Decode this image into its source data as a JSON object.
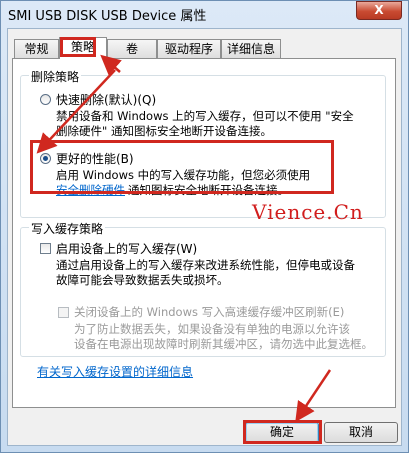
{
  "window": {
    "title": "SMI USB DISK USB Device 属性",
    "close_label": "X"
  },
  "tabs": [
    {
      "label": "常规"
    },
    {
      "label": "策略"
    },
    {
      "label": "卷"
    },
    {
      "label": "驱动程序"
    },
    {
      "label": "详细信息"
    }
  ],
  "removal_policy": {
    "title": "删除策略",
    "quick_label": "快速删除(默认)(Q)",
    "quick_desc_1": "禁用设备和 Windows 上的写入缓存，但可以不使用 \"安全",
    "quick_desc_2": "删除硬件\" 通知图标安全地断开设备连接。",
    "better_label": "更好的性能(B)",
    "better_desc_1": "启用 Windows 中的写入缓存功能，但您必须使用",
    "better_desc_link": "安全删除硬件",
    "better_desc_2": "通知图标安全地断开设备连接。"
  },
  "write_cache": {
    "title": "写入缓存策略",
    "enable_label": "启用设备上的写入缓存(W)",
    "enable_desc_1": "通过启用设备上的写入缓存来改进系统性能，但停电或设备",
    "enable_desc_2": "故障可能会导致数据丢失或损坏。",
    "flush_label": "关闭设备上的 Windows 写入高速缓存缓冲区刷新(E)",
    "flush_desc_1": "为了防止数据丢失，如果设备没有单独的电源以允许该",
    "flush_desc_2": "设备在电源出现故障时刷新其缓冲区，请勿选中此复选框。"
  },
  "more_info_link": "有关写入缓存设置的详细信息",
  "buttons": {
    "ok": "确定",
    "cancel": "取消"
  },
  "watermark": "Vience.Cn",
  "colors": {
    "annotation": "#d0281f",
    "link": "#0066cc"
  },
  "state": {
    "selected_policy": "better_performance",
    "write_cache_enabled": false,
    "flush_disabled": false
  }
}
